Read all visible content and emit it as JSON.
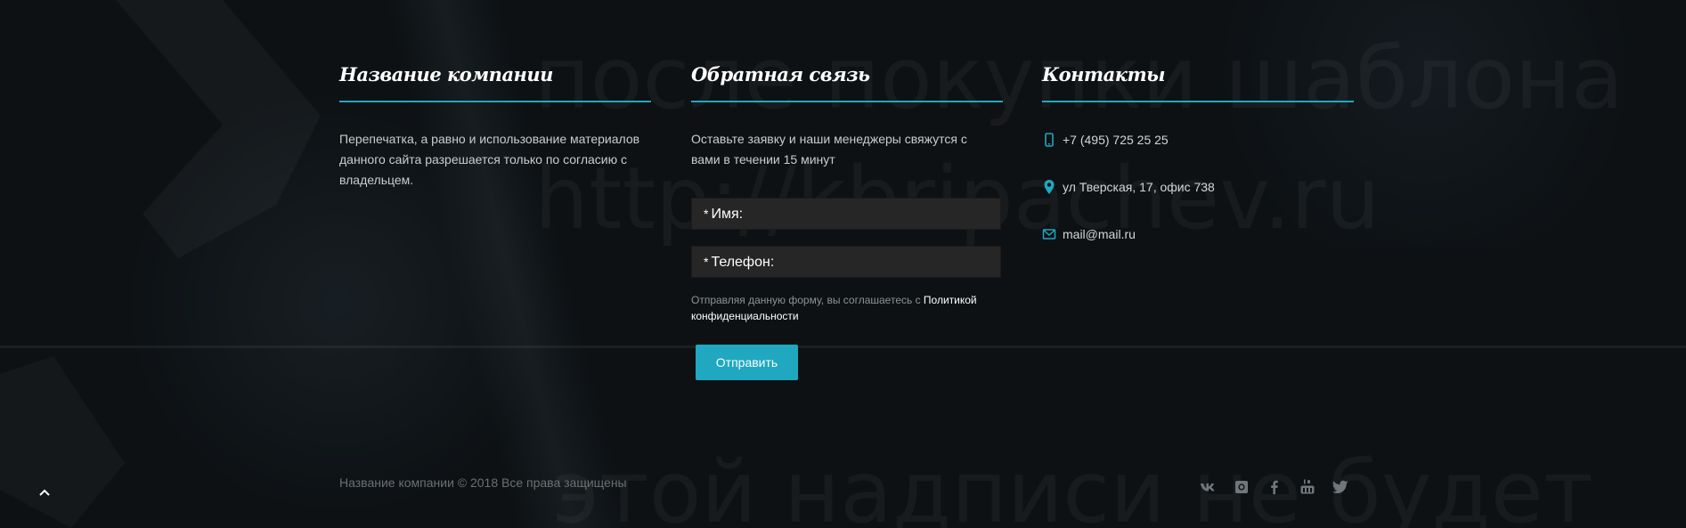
{
  "background": {
    "watermark_lines": [
      "после покупки шаблона",
      "http://kbripachev.ru",
      "этой надписи не будет"
    ]
  },
  "columns": {
    "company": {
      "title": "Название компании",
      "text": "Перепечатка, а равно и использование материалов данного сайта разрешается только по согласию с владельцем."
    },
    "feedback": {
      "title": "Обратная связь",
      "text": "Оставьте заявку и наши менеджеры свяжутся с вами в течении 15 минут",
      "name_label": "Имя:",
      "phone_label": "Телефон:",
      "required_mark": "*",
      "consent_text": "Отправляя данную форму, вы соглашаетесь с",
      "consent_link": "Политикой конфиденциальности",
      "submit_label": "Отправить"
    },
    "contacts": {
      "title": "Контакты",
      "phone": "+7 (495) 725 25 25",
      "address": "ул Тверская, 17, офис 738",
      "email": "mail@mail.ru",
      "icons": [
        "phone-icon",
        "location-pin-icon",
        "mail-icon"
      ]
    }
  },
  "footer": {
    "copyright": "Название компании © 2018 Все права защищены",
    "social_icons": [
      "vk-icon",
      "instagram-icon",
      "facebook-icon",
      "youtube-icon",
      "twitter-icon"
    ]
  },
  "colors": {
    "accent": "#1fa8bf",
    "background": "#0d1114"
  }
}
